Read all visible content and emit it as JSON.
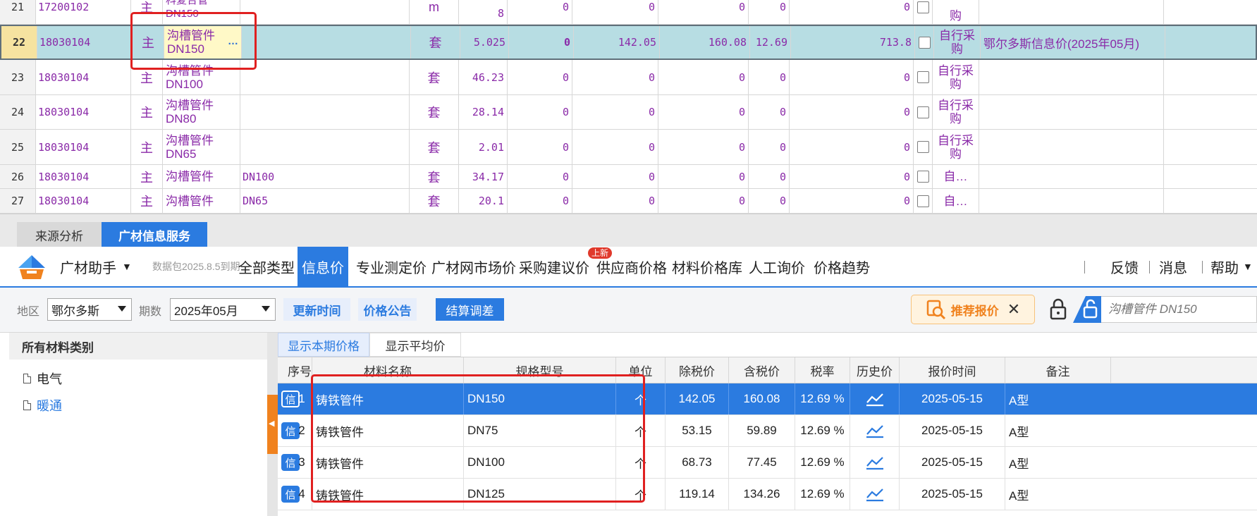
{
  "top_grid": {
    "partial_row": {
      "idx": "21",
      "code": "17200102",
      "main": "主",
      "name": "科复合管 DN150",
      "unit": "m",
      "qty": "8",
      "v1": "0",
      "v2": "0",
      "v3": "0",
      "v4": "0",
      "v5": "0",
      "src": "购"
    },
    "rows": [
      {
        "idx": "22",
        "code": "18030104",
        "main": "主",
        "name": "沟槽管件 DN150",
        "spec": "",
        "unit": "套",
        "qty": "5.025",
        "v1": "0",
        "v2": "142.05",
        "v3": "160.08",
        "v4": "12.69",
        "v5": "713.8",
        "src": "自行采购",
        "note": "鄂尔多斯信息价(2025年05月)",
        "selected": true
      },
      {
        "idx": "23",
        "code": "18030104",
        "main": "主",
        "name": "沟槽管件 DN100",
        "spec": "",
        "unit": "套",
        "qty": "46.23",
        "v1": "0",
        "v2": "0",
        "v3": "0",
        "v4": "0",
        "v5": "0",
        "src": "自行采购",
        "note": ""
      },
      {
        "idx": "24",
        "code": "18030104",
        "main": "主",
        "name": "沟槽管件 DN80",
        "spec": "",
        "unit": "套",
        "qty": "28.14",
        "v1": "0",
        "v2": "0",
        "v3": "0",
        "v4": "0",
        "v5": "0",
        "src": "自行采购",
        "note": ""
      },
      {
        "idx": "25",
        "code": "18030104",
        "main": "主",
        "name": "沟槽管件 DN65",
        "spec": "",
        "unit": "套",
        "qty": "2.01",
        "v1": "0",
        "v2": "0",
        "v3": "0",
        "v4": "0",
        "v5": "0",
        "src": "自行采购",
        "note": ""
      },
      {
        "idx": "26",
        "code": "18030104",
        "main": "主",
        "name": "沟槽管件",
        "spec": "DN100",
        "unit": "套",
        "qty": "34.17",
        "v1": "0",
        "v2": "0",
        "v3": "0",
        "v4": "0",
        "v5": "0",
        "src": "自…",
        "note": ""
      },
      {
        "idx": "27",
        "code": "18030104",
        "main": "主",
        "name": "沟槽管件",
        "spec": "DN65",
        "unit": "套",
        "qty": "20.1",
        "v1": "0",
        "v2": "0",
        "v3": "0",
        "v4": "0",
        "v5": "0",
        "src": "自…",
        "note": ""
      }
    ],
    "ellipsis": "…"
  },
  "bottom_tabs": {
    "source_analysis": "来源分析",
    "info_service": "广材信息服务"
  },
  "toolbar": {
    "assistant": "广材助手",
    "package": "数据包2025.8.5到期",
    "items": [
      "全部类型",
      "信息价",
      "专业测定价",
      "广材网市场价",
      "采购建议价",
      "供应商价格",
      "材料价格库",
      "人工询价",
      "价格趋势"
    ],
    "new_badge": "上新",
    "right": [
      "反馈",
      "消息",
      "帮助"
    ]
  },
  "filter": {
    "region_label": "地区",
    "region_value": "鄂尔多斯",
    "period_label": "期数",
    "period_value": "2025年05月",
    "update_time": "更新时间",
    "price_notice": "价格公告",
    "settlement": "结算调差",
    "recommend": "推荐报价",
    "search_placeholder": "沟槽管件 DN150"
  },
  "categories": {
    "title": "所有材料类别",
    "items": [
      "电气",
      "暖通"
    ]
  },
  "result": {
    "subtabs": [
      "显示本期价格",
      "显示平均价"
    ],
    "headers": [
      "序号",
      "材料名称",
      "规格型号",
      "单位",
      "除税价",
      "含税价",
      "税率",
      "历史价",
      "报价时间",
      "备注"
    ],
    "badge": "信",
    "rows": [
      {
        "no": "1",
        "name": "铸铁管件",
        "spec": "DN150",
        "unit": "个",
        "excl": "142.05",
        "incl": "160.08",
        "rate": "12.69 %",
        "time": "2025-05-15",
        "note": "A型",
        "selected": true
      },
      {
        "no": "2",
        "name": "铸铁管件",
        "spec": "DN75",
        "unit": "个",
        "excl": "53.15",
        "incl": "59.89",
        "rate": "12.69 %",
        "time": "2025-05-15",
        "note": "A型"
      },
      {
        "no": "3",
        "name": "铸铁管件",
        "spec": "DN100",
        "unit": "个",
        "excl": "68.73",
        "incl": "77.45",
        "rate": "12.69 %",
        "time": "2025-05-15",
        "note": "A型"
      },
      {
        "no": "4",
        "name": "铸铁管件",
        "spec": "DN125",
        "unit": "个",
        "excl": "119.14",
        "incl": "134.26",
        "rate": "12.69 %",
        "time": "2025-05-15",
        "note": "A型"
      }
    ]
  },
  "colors": {
    "accent": "#2b7be0",
    "highlight": "#e02020",
    "material_text": "#8a2aa8",
    "selected_row": "#b7dde3",
    "orange": "#f0821e"
  }
}
